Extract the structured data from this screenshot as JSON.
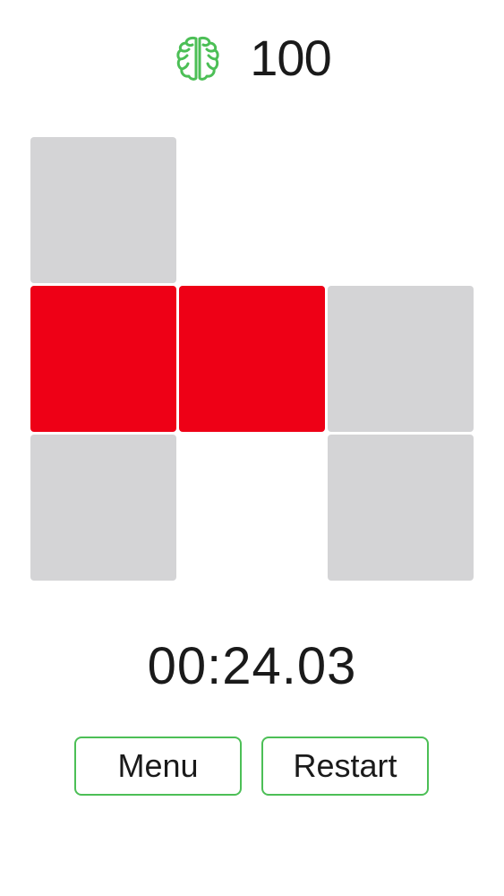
{
  "header": {
    "icon": "brain-icon",
    "score": "100"
  },
  "colors": {
    "accent": "#4cbf56",
    "tile_empty": "#d4d4d6",
    "tile_active": "#ee0016"
  },
  "board": {
    "columns": 3,
    "rows": 3,
    "tiles": [
      {
        "row": 0,
        "col": 0,
        "state": "gray"
      },
      {
        "row": 1,
        "col": 0,
        "state": "red"
      },
      {
        "row": 1,
        "col": 1,
        "state": "red"
      },
      {
        "row": 1,
        "col": 2,
        "state": "gray"
      },
      {
        "row": 2,
        "col": 0,
        "state": "gray"
      },
      {
        "row": 2,
        "col": 2,
        "state": "gray"
      }
    ]
  },
  "timer": "00:24.03",
  "buttons": {
    "menu_label": "Menu",
    "restart_label": "Restart"
  }
}
